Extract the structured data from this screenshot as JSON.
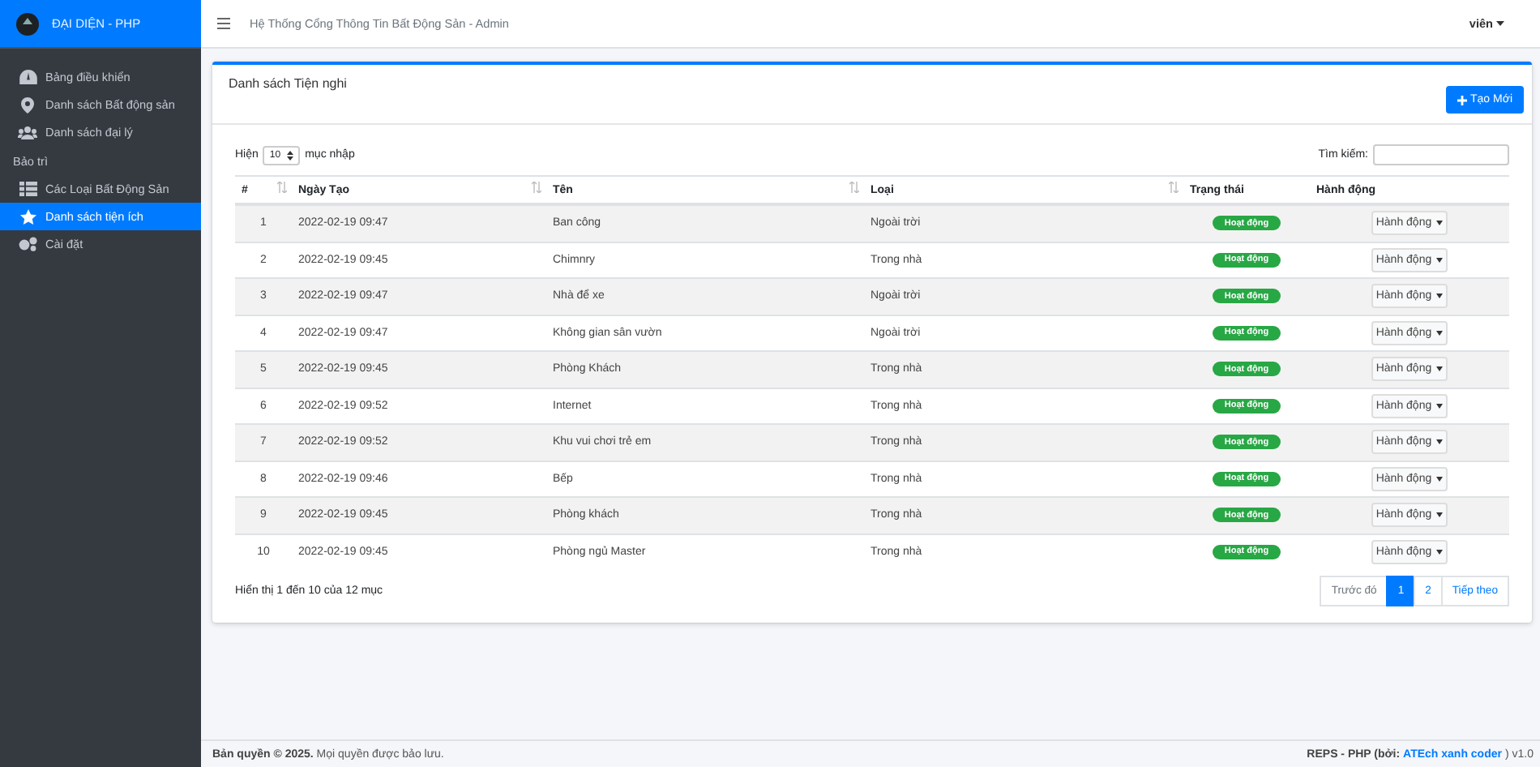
{
  "sidebar": {
    "brand": "ĐẠI DIỆN - PHP",
    "items": [
      {
        "kind": "link",
        "label": "Bảng điều khiển",
        "selected": false
      },
      {
        "kind": "link",
        "label": "Danh sách Bất động sản",
        "selected": false
      },
      {
        "kind": "link",
        "label": "Danh sách đại lý",
        "selected": false
      },
      {
        "kind": "header",
        "label": "Bảo trì"
      },
      {
        "kind": "link",
        "label": "Các Loại Bất Động Sản",
        "selected": false
      },
      {
        "kind": "link",
        "label": "Danh sách tiện ích",
        "selected": true
      },
      {
        "kind": "link",
        "label": "Cài đặt",
        "selected": false
      }
    ]
  },
  "topbar": {
    "title": "Hệ Thống Cổng Thông Tin Bất Động Sản - Admin",
    "user": "viên"
  },
  "card": {
    "title": "Danh sách Tiện nghi",
    "create_button": "Tạo Mới",
    "length_before": "Hiện",
    "length_value": "10",
    "length_after": "mục nhập",
    "search_label": "Tìm kiếm:",
    "columns": [
      {
        "label": "#",
        "sortable": true
      },
      {
        "label": "Ngày Tạo",
        "sortable": true
      },
      {
        "label": "Tên",
        "sortable": true
      },
      {
        "label": "Loại",
        "sortable": true
      },
      {
        "label": "Trạng thái",
        "sortable": false
      },
      {
        "label": "Hành động",
        "sortable": false
      }
    ],
    "rows": [
      {
        "index": "1",
        "created": "2022-02-19 09:47",
        "name": "Ban công",
        "type": "Ngoài trời",
        "status": "Hoạt động",
        "action": "Hành động"
      },
      {
        "index": "2",
        "created": "2022-02-19 09:45",
        "name": "Chimnry",
        "type": "Trong nhà",
        "status": "Hoạt động",
        "action": "Hành động"
      },
      {
        "index": "3",
        "created": "2022-02-19 09:47",
        "name": "Nhà để xe",
        "type": "Ngoài trời",
        "status": "Hoạt động",
        "action": "Hành động"
      },
      {
        "index": "4",
        "created": "2022-02-19 09:47",
        "name": "Không gian sân vườn",
        "type": "Ngoài trời",
        "status": "Hoạt động",
        "action": "Hành động"
      },
      {
        "index": "5",
        "created": "2022-02-19 09:45",
        "name": "Phòng Khách",
        "type": "Trong nhà",
        "status": "Hoạt động",
        "action": "Hành động"
      },
      {
        "index": "6",
        "created": "2022-02-19 09:52",
        "name": "Internet",
        "type": "Trong nhà",
        "status": "Hoạt động",
        "action": "Hành động"
      },
      {
        "index": "7",
        "created": "2022-02-19 09:52",
        "name": "Khu vui chơi trẻ em",
        "type": "Trong nhà",
        "status": "Hoạt động",
        "action": "Hành động"
      },
      {
        "index": "8",
        "created": "2022-02-19 09:46",
        "name": "Bếp",
        "type": "Trong nhà",
        "status": "Hoạt động",
        "action": "Hành động"
      },
      {
        "index": "9",
        "created": "2022-02-19 09:45",
        "name": "Phòng khách",
        "type": "Trong nhà",
        "status": "Hoạt động",
        "action": "Hành động"
      },
      {
        "index": "10",
        "created": "2022-02-19 09:45",
        "name": "Phòng ngủ Master",
        "type": "Trong nhà",
        "status": "Hoạt động",
        "action": "Hành động"
      }
    ],
    "info": "Hiển thị 1 đến 10 của 12 mục",
    "pagination": [
      {
        "label": "Trước đó",
        "selected": false,
        "disabled": true
      },
      {
        "label": "1",
        "selected": true,
        "disabled": false
      },
      {
        "label": "2",
        "selected": false,
        "disabled": false
      },
      {
        "label": "Tiếp theo",
        "selected": false,
        "disabled": false
      }
    ]
  },
  "footer": {
    "copyright": "**Bản quyền © 2025.** Mọi quyền được bảo lưu.",
    "credit_prefix": "REPS - PHP (bởi:",
    "credit_link": "ATEch xanh coder",
    "credit_suffix": ") v1.0"
  }
}
